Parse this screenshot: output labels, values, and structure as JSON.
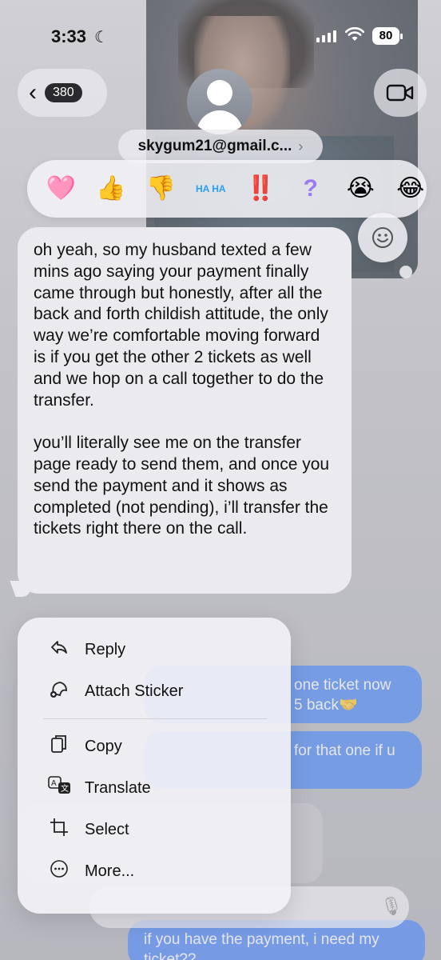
{
  "status_bar": {
    "time": "3:33",
    "battery": "80"
  },
  "nav": {
    "back_count": "380",
    "contact": "skygum21@gmail.c...",
    "contact_chevron": "›"
  },
  "tapbacks": [
    {
      "name": "heart-reaction",
      "glyph": "🩷"
    },
    {
      "name": "thumbs-up-reaction",
      "glyph": "👍"
    },
    {
      "name": "thumbs-down-reaction",
      "glyph": "👎"
    },
    {
      "name": "haha-reaction",
      "glyph": "HA HA"
    },
    {
      "name": "exclamation-reaction",
      "glyph": "‼️"
    },
    {
      "name": "question-reaction",
      "glyph": "?"
    },
    {
      "name": "crying-reaction",
      "glyph": "😭"
    },
    {
      "name": "laughing-reaction",
      "glyph": "😂"
    }
  ],
  "message": {
    "paragraph1": "oh yeah, so my husband texted a few mins ago saying your payment finally came through but honestly, after all the back and forth childish attitude, the only way we’re comfortable moving forward is if you get the other 2 tickets as well and we hop on a call together to do the transfer.",
    "paragraph2": "you’ll literally see me on the transfer page ready to send them, and once you send the payment and it shows as completed (not pending), i’ll transfer the tickets right there on the call."
  },
  "background_bubbles": {
    "blue1_line1": "one ticket now",
    "blue1_line2": "5 back🤝",
    "blue2": "for that one if u",
    "bottom_line1": "if you have the payment, i need my",
    "bottom_line2": "ticket??"
  },
  "menu": {
    "reply": "Reply",
    "attach_sticker": "Attach Sticker",
    "copy": "Copy",
    "translate": "Translate",
    "select": "Select",
    "more": "More..."
  },
  "colors": {
    "imessage_blue": "#3478f6",
    "bubble_gray": "#ebebef"
  }
}
